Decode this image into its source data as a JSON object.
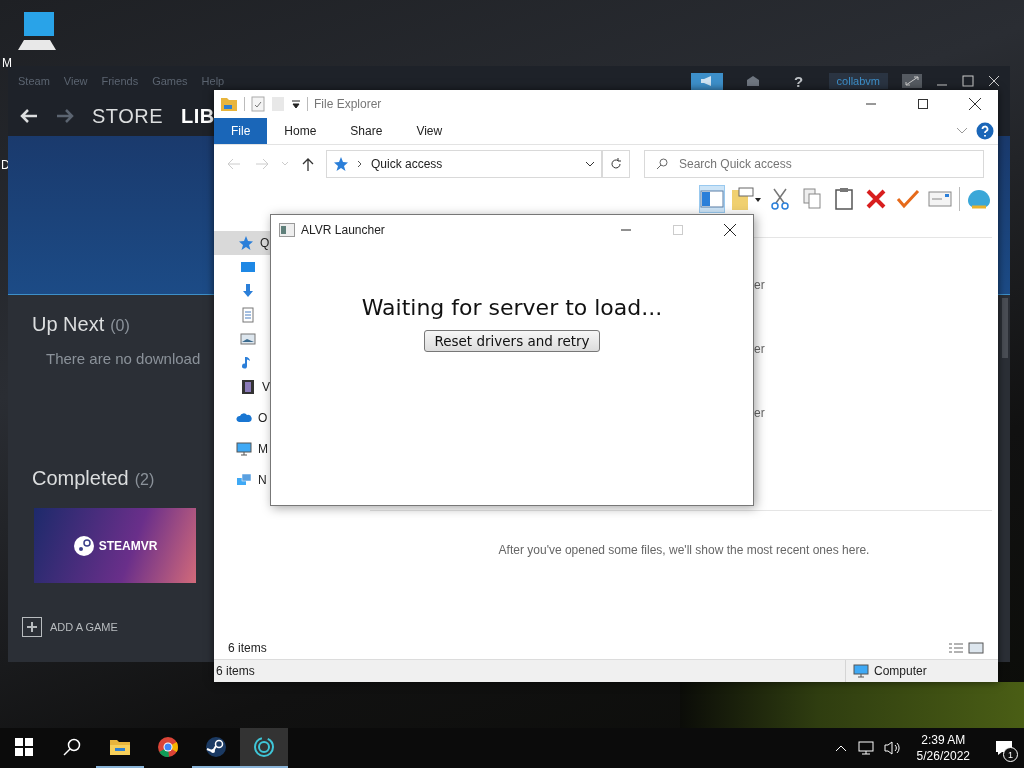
{
  "desktop": {
    "icon_label": "M",
    "edge_label": "D"
  },
  "steam": {
    "menu": [
      "Steam",
      "View",
      "Friends",
      "Games",
      "Help"
    ],
    "help_label": "?",
    "account": "collabvm",
    "nav": [
      {
        "label": "STORE",
        "selected": false
      },
      {
        "label": "LIB",
        "selected": true
      }
    ],
    "up_next": {
      "title": "Up Next",
      "count": "(0)",
      "message": "There are no download"
    },
    "completed": {
      "title": "Completed",
      "count": "(2)"
    },
    "tile": {
      "label": "STEAMVR"
    },
    "add_game": "ADD A GAME"
  },
  "explorer": {
    "title": "File Explorer",
    "tabs": [
      {
        "label": "File",
        "selected": true
      },
      {
        "label": "Home",
        "selected": false
      },
      {
        "label": "Share",
        "selected": false
      },
      {
        "label": "View",
        "selected": false
      }
    ],
    "address": "Quick access",
    "search_placeholder": "Search Quick access",
    "nav": [
      {
        "kind": "star",
        "label": "Q",
        "selected": true
      },
      {
        "kind": "desktop",
        "selected": false
      },
      {
        "kind": "download",
        "selected": false
      },
      {
        "kind": "document",
        "selected": false
      },
      {
        "kind": "picture",
        "selected": false
      },
      {
        "kind": "music",
        "selected": false
      },
      {
        "kind": "video",
        "label": "V",
        "selected": false
      },
      {
        "kind": "cloud",
        "label": "O",
        "selected": false
      },
      {
        "kind": "computer",
        "label": "M",
        "selected": false
      },
      {
        "kind": "network",
        "label": "N",
        "selected": false
      }
    ],
    "fragments": [
      "er",
      "er",
      "er"
    ],
    "recent_message": "After you've opened some files, we'll show the most recent ones here.",
    "item_count": "6 items",
    "status": {
      "items": "6 items",
      "location": "Computer"
    }
  },
  "alvr": {
    "title": "ALVR Launcher",
    "message": "Waiting for server to load...",
    "button": "Reset drivers and retry",
    "maximize_disabled": true
  },
  "taskbar": {
    "apps": [
      {
        "kind": "explorer",
        "running": true,
        "selected": false
      },
      {
        "kind": "chrome",
        "running": false,
        "selected": false
      },
      {
        "kind": "steam",
        "running": true,
        "selected": false
      },
      {
        "kind": "alvr",
        "running": true,
        "selected": true
      }
    ],
    "time": "2:39 AM",
    "date": "5/26/2022",
    "notifications": "1"
  }
}
